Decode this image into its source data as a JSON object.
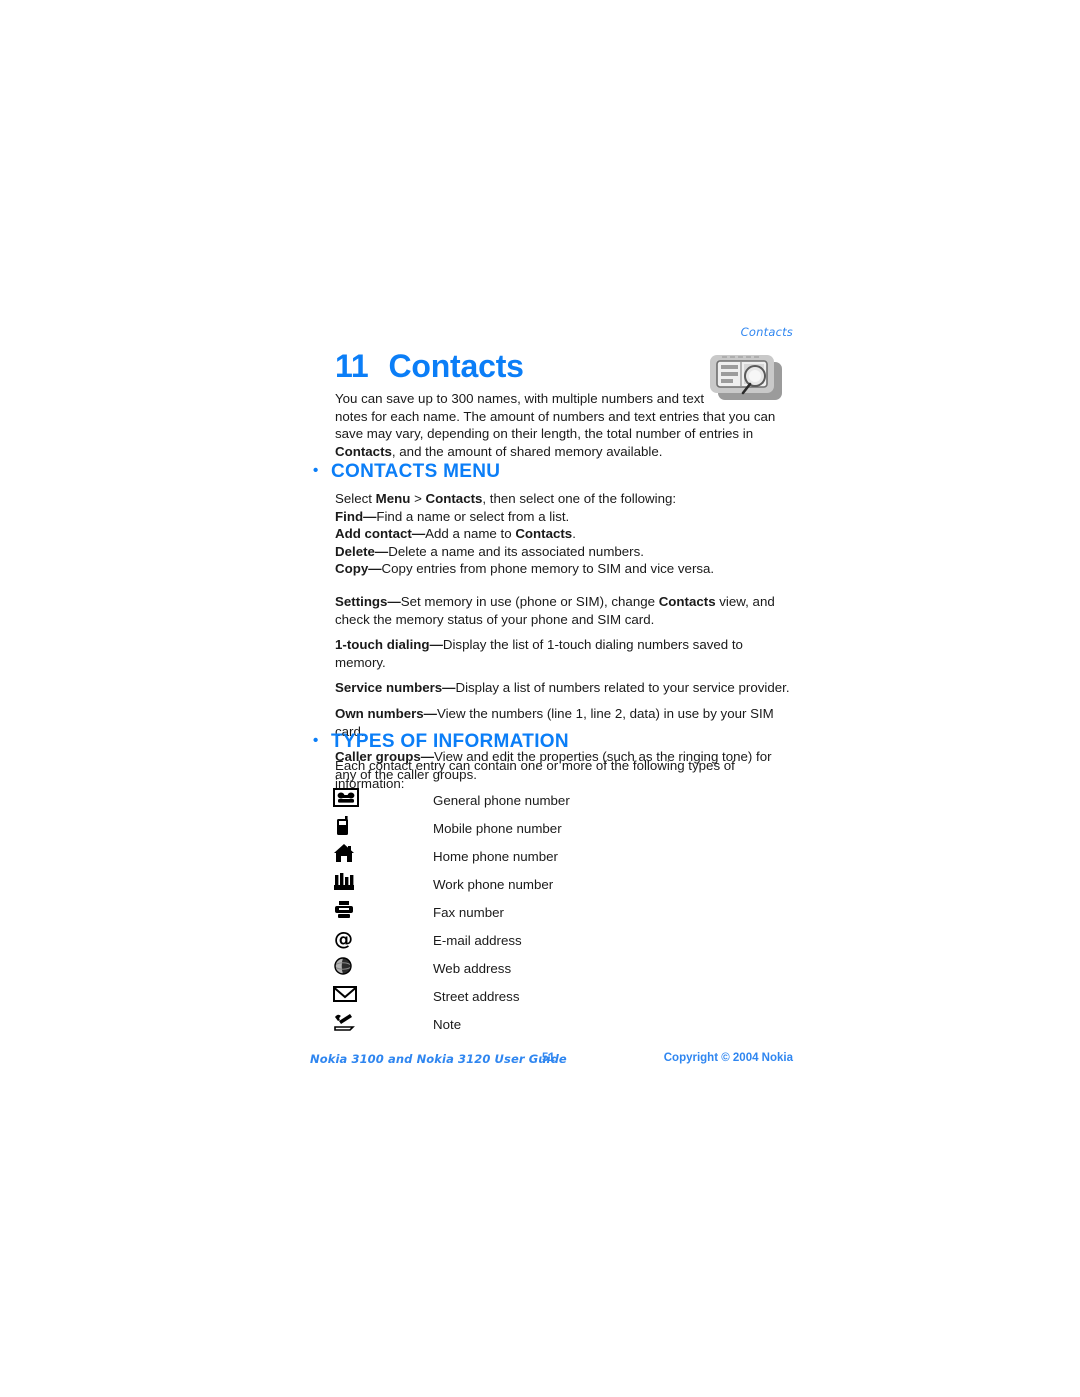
{
  "running_header": "Contacts",
  "chapter": {
    "number": "11",
    "title": "Contacts",
    "icon": "contact-card-search-icon"
  },
  "intro": {
    "line1": "You can save up to 300 names, with multiple numbers and text",
    "rest_a": "notes for each name. The amount of numbers and text entries that you can save may vary, depending on their length, the total number of entries in ",
    "rest_bold": "Contacts",
    "rest_b": ", and the amount of shared memory available."
  },
  "sections": {
    "contacts_menu": {
      "heading": "CONTACTS MENU",
      "bullet": "•",
      "intro_a": "Select ",
      "intro_b1": "Menu",
      "intro_c": " > ",
      "intro_b2": "Contacts",
      "intro_d": ", then select one of the following:",
      "items": [
        {
          "term": "Find",
          "dash": "—",
          "desc": "Find a name or select from a list."
        },
        {
          "term": "Add contact",
          "dash": "—",
          "desc_a": "Add a name to ",
          "desc_bold": "Contacts",
          "desc_b": "."
        },
        {
          "term": "Delete",
          "dash": "—",
          "desc": "Delete a name and its associated numbers."
        },
        {
          "term": "Copy",
          "dash": "—",
          "desc": "Copy entries from phone memory to SIM and vice versa."
        },
        {
          "term": "Settings",
          "dash": "—",
          "desc_a": "Set memory in use (phone or SIM), change ",
          "desc_bold": "Contacts",
          "desc_b": " view, and check the memory status of your phone and SIM card."
        },
        {
          "term": "1-touch dialing",
          "dash": "—",
          "desc": "Display the list of 1-touch dialing numbers saved to memory."
        },
        {
          "term": "Service numbers",
          "dash": "—",
          "desc": "Display a list of numbers related to your service provider."
        },
        {
          "term": "Own numbers",
          "dash": "—",
          "desc": "View the numbers (line 1, line 2, data) in use by your SIM card."
        },
        {
          "term": "Caller groups",
          "dash": "—",
          "desc": "View and edit the properties (such as the ringing tone) for any of the caller groups."
        }
      ]
    },
    "types_of_information": {
      "heading": "TYPES OF INFORMATION",
      "bullet": "•",
      "intro": "Each contact entry can contain one or more of the following types of information:",
      "rows": [
        {
          "icon": "telephone-icon",
          "label": "General phone number"
        },
        {
          "icon": "mobile-phone-icon",
          "label": "Mobile phone number"
        },
        {
          "icon": "house-icon",
          "label": "Home phone number"
        },
        {
          "icon": "factory-icon",
          "label": "Work phone number"
        },
        {
          "icon": "fax-machine-icon",
          "label": "Fax number"
        },
        {
          "icon": "at-sign-icon",
          "label": "E-mail address"
        },
        {
          "icon": "globe-icon",
          "label": "Web address"
        },
        {
          "icon": "envelope-icon",
          "label": "Street address"
        },
        {
          "icon": "pen-note-icon",
          "label": "Note"
        }
      ]
    }
  },
  "footer": {
    "guide": "Nokia 3100 and Nokia 3120 User Guide",
    "page_number": "51",
    "copyright": "Copyright © 2004 Nokia"
  },
  "colors": {
    "accent_blue": "#0b7ef7",
    "footer_blue": "#2f86f0",
    "body_text": "#1a1a1a",
    "icon_grey": "#8d8d8d"
  }
}
